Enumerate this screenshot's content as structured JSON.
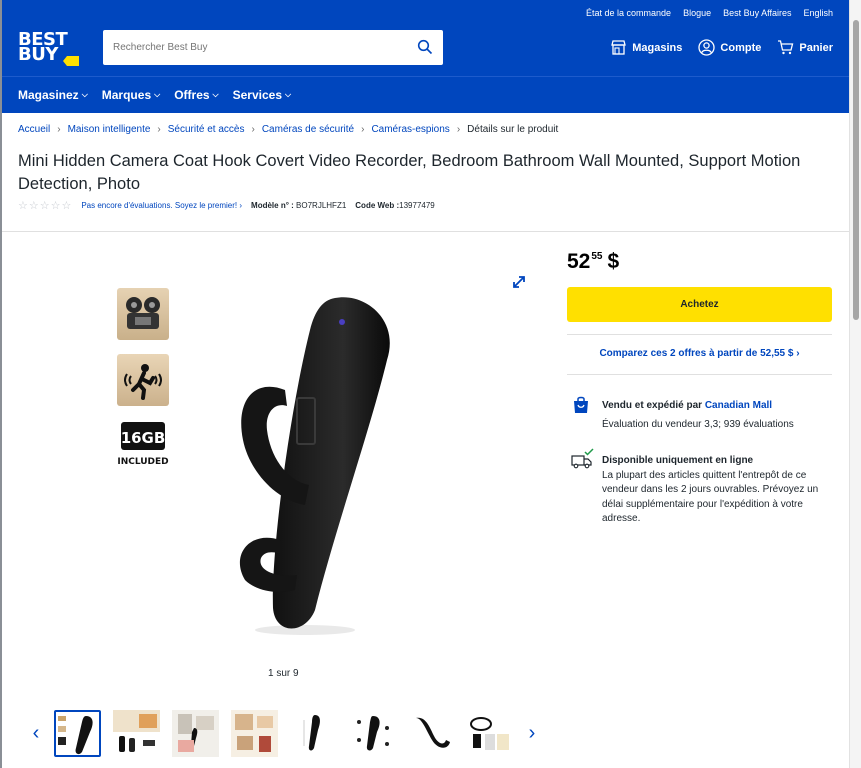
{
  "utility_links": [
    "État de la commande",
    "Blogue",
    "Best Buy Affaires",
    "English"
  ],
  "logo": {
    "line1": "BEST",
    "line2": "BUY"
  },
  "search": {
    "placeholder": "Rechercher Best Buy"
  },
  "header_actions": {
    "stores": "Magasins",
    "account": "Compte",
    "cart": "Panier"
  },
  "nav": [
    "Magasinez",
    "Marques",
    "Offres",
    "Services"
  ],
  "breadcrumb": {
    "links": [
      "Accueil",
      "Maison intelligente",
      "Sécurité et accès",
      "Caméras de sécurité",
      "Caméras-espions"
    ],
    "current": "Détails sur le produit"
  },
  "product": {
    "title": "Mini Hidden Camera Coat Hook Covert Video Recorder, Bedroom Bathroom Wall Mounted, Support Motion Detection, Photo",
    "rating_text": "Pas encore d'évaluations. Soyez le premier!",
    "model_label": "Modèle n° :",
    "model_value": "BO7RJLHFZ1",
    "web_code_label": "Code Web :",
    "web_code_value": "13977479"
  },
  "gallery": {
    "counter": "1 sur 9",
    "badge_16gb": "16GB",
    "badge_included": "INCLUDED"
  },
  "buy_box": {
    "price_dollars": "52",
    "price_cents": "55",
    "currency": "$",
    "buy_label": "Achetez",
    "compare_text": "Comparez ces 2 offres à partir de 52,55 $",
    "sold_by_label": "Vendu et expédié par",
    "seller_name": "Canadian Mall",
    "seller_rating": "Évaluation du vendeur 3,3; 939 évaluations",
    "availability_title": "Disponible uniquement en ligne",
    "availability_text": "La plupart des articles quittent l'entrepôt de ce vendeur dans les 2 jours ouvrables. Prévoyez un délai supplémentaire pour l'expédition à votre adresse."
  },
  "colors": {
    "brand_blue": "#0046be",
    "buy_yellow": "#ffe000"
  },
  "icons": [
    "search-icon",
    "store-icon",
    "account-icon",
    "cart-icon",
    "expand-icon",
    "shopping-bag-icon",
    "delivery-truck-icon",
    "chevron-left-icon",
    "chevron-right-icon"
  ]
}
